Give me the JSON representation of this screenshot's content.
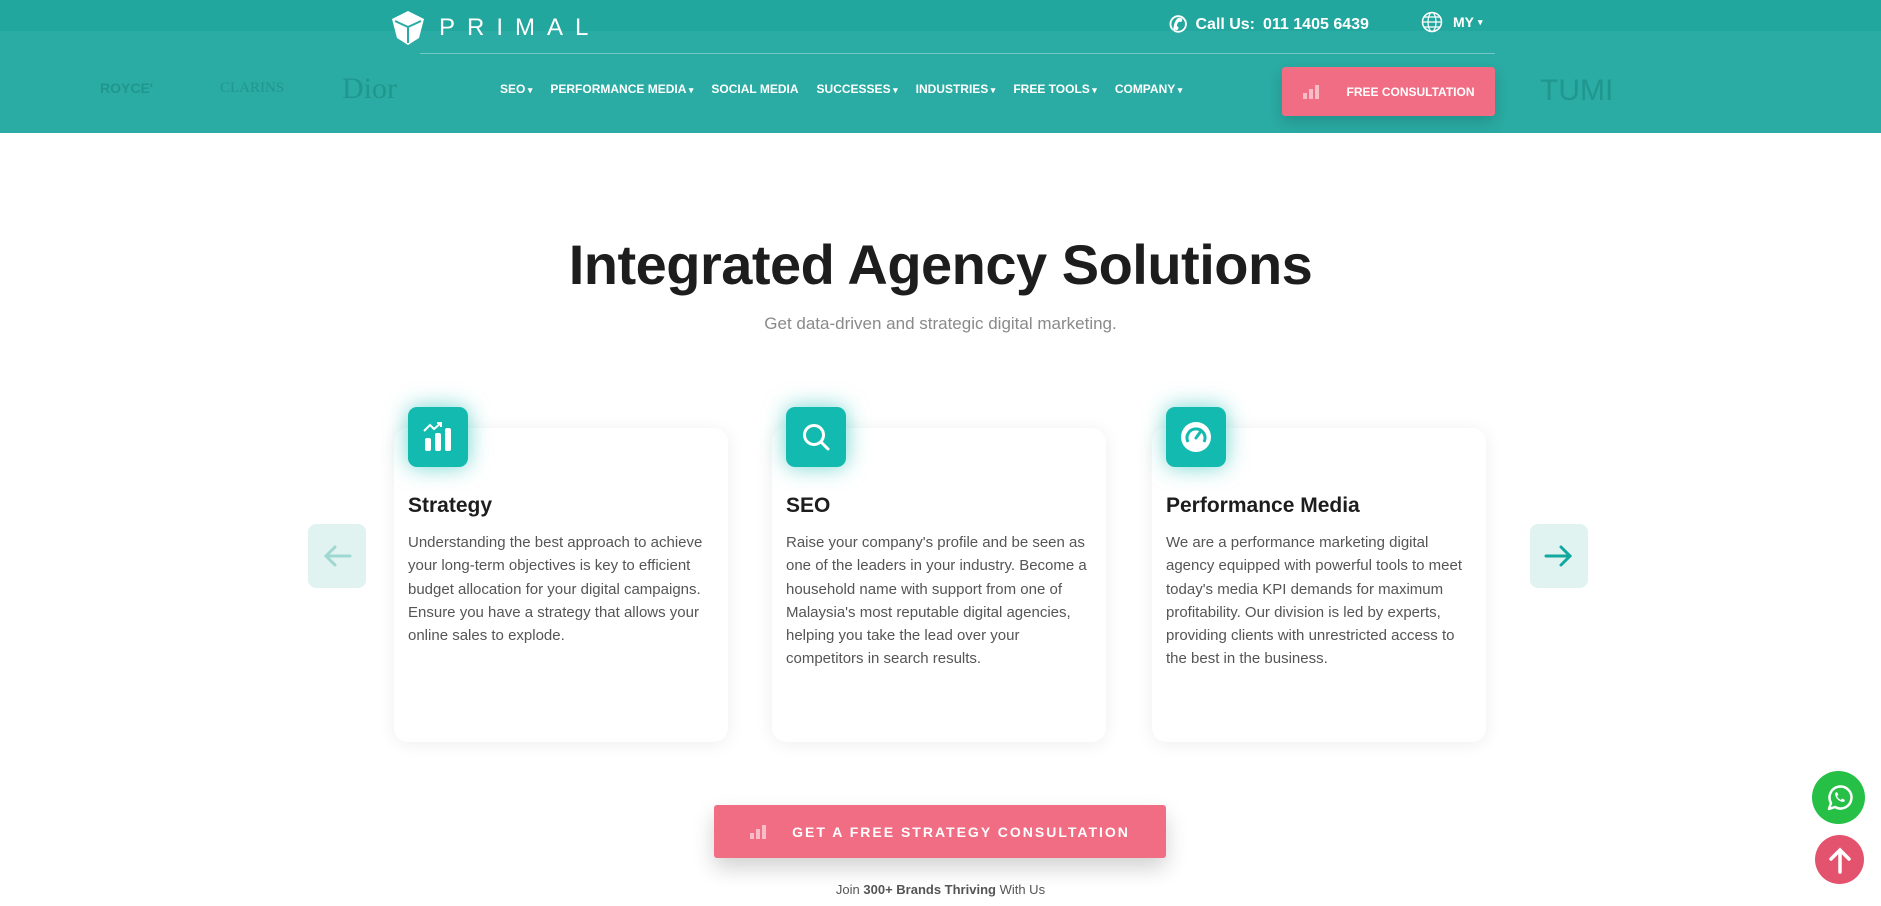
{
  "header": {
    "logo_text": "PRIMAL",
    "call_label": "Call Us:",
    "phone": "011 1405 6439",
    "language": "MY",
    "background_brands": [
      "ROYCE'",
      "CLARINS",
      "Dior",
      "TUMI"
    ],
    "nav": [
      {
        "label": "SEO",
        "dropdown": true
      },
      {
        "label": "PERFORMANCE MEDIA",
        "dropdown": true
      },
      {
        "label": "SOCIAL MEDIA",
        "dropdown": false
      },
      {
        "label": "SUCCESSES",
        "dropdown": true
      },
      {
        "label": "INDUSTRIES",
        "dropdown": true
      },
      {
        "label": "FREE TOOLS",
        "dropdown": true
      },
      {
        "label": "COMPANY",
        "dropdown": true
      }
    ],
    "cta": "FREE CONSULTATION"
  },
  "main": {
    "title": "Integrated Agency Solutions",
    "subtitle": "Get data-driven and strategic digital marketing.",
    "cards": [
      {
        "icon": "chart-icon",
        "title": "Strategy",
        "text": "Understanding the best approach to achieve your long-term objectives is key to efficient budget allocation for your digital campaigns. Ensure you have a strategy that allows your online sales to explode."
      },
      {
        "icon": "search-icon",
        "title": "SEO",
        "text": "Raise your company's profile and be seen as one of the leaders in your industry. Become a household name with support from one of Malaysia's most reputable digital agencies, helping you take the lead over your competitors in search results."
      },
      {
        "icon": "speedometer-icon",
        "title": "Performance Media",
        "text": "We are a performance marketing digital agency equipped with powerful tools to meet today's media KPI demands for maximum profitability. Our division is led by experts, providing clients with unrestricted access to the best in the business."
      }
    ],
    "cta": "GET A FREE STRATEGY CONSULTATION",
    "join_pre": "Join ",
    "join_bold": "300+ Brands Thriving",
    "join_post": " With Us"
  },
  "colors": {
    "teal": "#2aaba3",
    "accent": "#13bab0",
    "pink": "#f06d84",
    "whatsapp": "#25c045",
    "scroll_top": "#e4536d"
  }
}
